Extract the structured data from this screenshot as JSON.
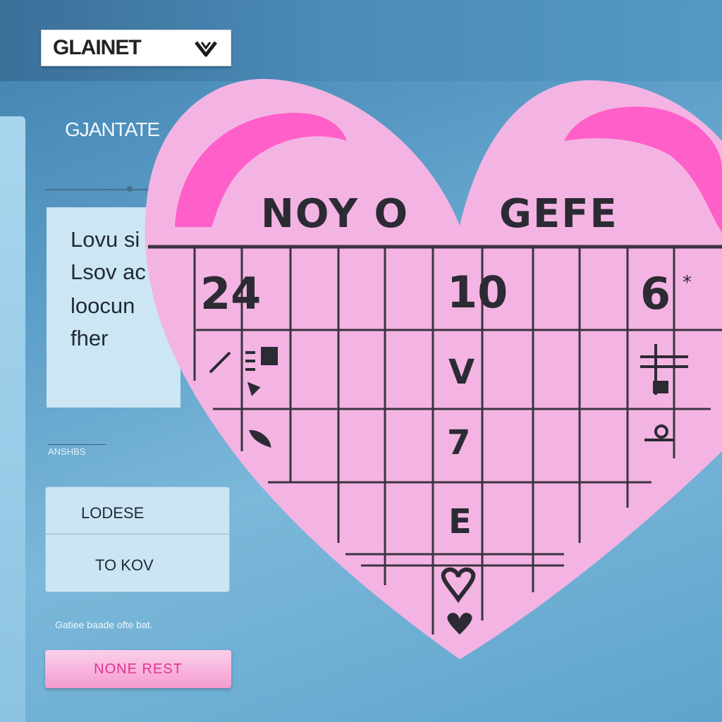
{
  "header": {
    "dropdown_value": "GLAINET"
  },
  "sidebar": {
    "section_title": "GJANTATE",
    "text_card_lines": [
      "Lovu si",
      "Lsov ac",
      "loocun",
      "fher"
    ],
    "small_label": "ANSHBS",
    "list_items": [
      "LODESE",
      "TO KOV"
    ],
    "caption": "Gatiee baade ofte bat.",
    "button_label": "NONE REST"
  },
  "calendar": {
    "header_left": "NOY O",
    "header_right": "GEFE",
    "cells": [
      {
        "key": "n24",
        "text": "24"
      },
      {
        "key": "n10",
        "text": "10"
      },
      {
        "key": "n6",
        "text": "6"
      },
      {
        "key": "star",
        "text": "*"
      },
      {
        "key": "v",
        "text": "V"
      },
      {
        "key": "seven",
        "text": "7"
      },
      {
        "key": "e",
        "text": "E"
      }
    ]
  },
  "colors": {
    "background": "#5a9cc6",
    "heart_fill": "#f3b4e3",
    "heart_accent": "#ff5fc9",
    "button_text": "#e0348e",
    "grid_line": "#3a3440"
  }
}
